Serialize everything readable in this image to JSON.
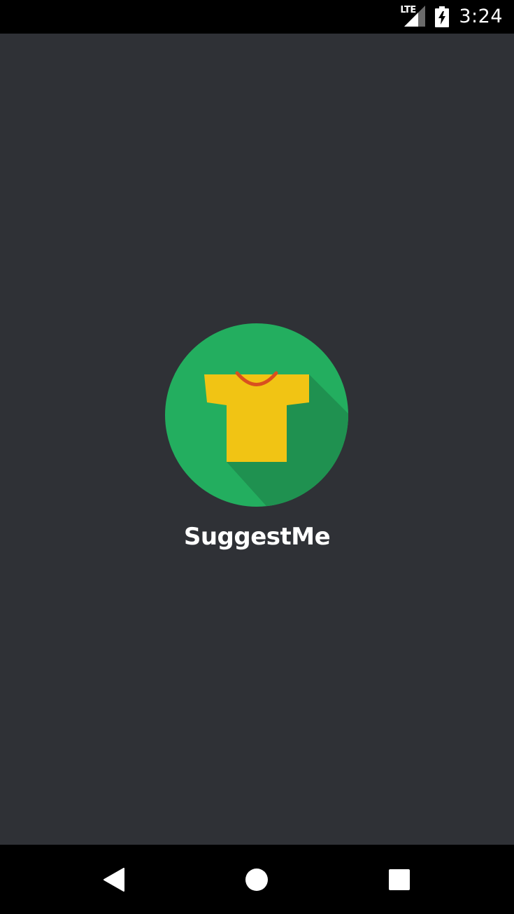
{
  "status_bar": {
    "network_label": "LTE",
    "time": "3:24",
    "icons": [
      "lte-signal-icon",
      "battery-charging-icon"
    ]
  },
  "splash": {
    "app_name": "SuggestMe",
    "logo_icon": "tshirt-logo-icon",
    "colors": {
      "background": "#2f3136",
      "logo_circle": "#23ae5f",
      "logo_shadow": "#1f9150",
      "shirt": "#f1c414",
      "collar": "#d9501f"
    }
  },
  "nav_bar": {
    "icons": [
      "back-icon",
      "home-icon",
      "recents-icon"
    ]
  }
}
